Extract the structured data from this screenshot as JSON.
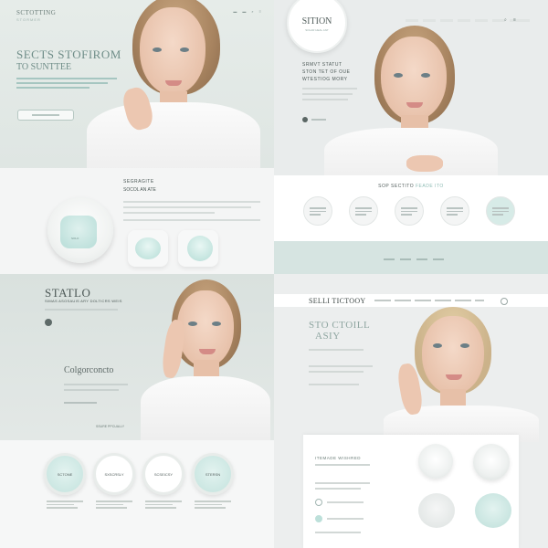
{
  "panel_1": {
    "brand": "SCTOTTING",
    "brand_sub": "STORMER",
    "hero_title": "SECTS STOFIROM",
    "hero_subtitle": "TO SUNTTEE"
  },
  "panel_2": {
    "logo": "SITION",
    "band_title_dark": "SOP SECTITO",
    "band_title_light": "FEADE ITO",
    "hero_lines": [
      "SRMVT STATUT",
      "STON TET OF OUE",
      "WTESTIOG MORY"
    ]
  },
  "panel_3": {
    "title": "STATLO",
    "subtitle": "SIMAS ASOSAUIS ARY DOLTICRS WEIS",
    "heading": "Colgorconcto",
    "pill": "SSURE PPCUALLY",
    "rings": [
      "SCTONE",
      "SXSCRSLY",
      "SCSEICSY",
      "STERSN"
    ]
  },
  "panel_4": {
    "brand": "SELLI TICTOOY",
    "title_line_1": "STO CTOILL",
    "title_line_2": "ASIY",
    "card_title": "ITEMADE WISHRED"
  }
}
